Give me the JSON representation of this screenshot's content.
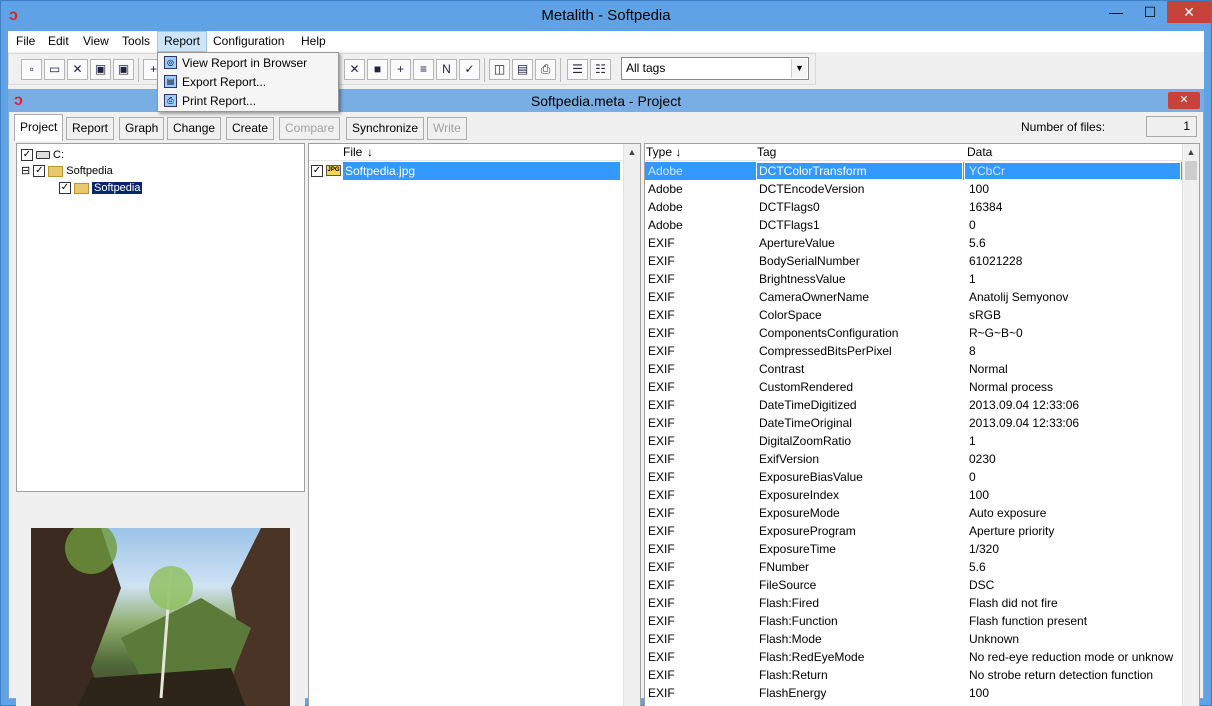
{
  "window": {
    "title": "Metalith - Softpedia",
    "min": "—",
    "max": "☐",
    "close": "✕"
  },
  "menu": [
    "File",
    "Edit",
    "View",
    "Tools",
    "Report",
    "Configuration",
    "Help"
  ],
  "report_menu": [
    "View Report in Browser",
    "Export Report...",
    "Print Report..."
  ],
  "toolbar": {
    "tag_filter": "All tags"
  },
  "project": {
    "title": "Softpedia.meta - Project",
    "close": "✕",
    "tabs": [
      "Project",
      "Report",
      "Graph",
      "Change",
      "Create",
      "Compare",
      "Synchronize",
      "Write"
    ],
    "number_of_files_label": "Number of files:",
    "number_of_files": "1"
  },
  "tree": {
    "drive": "C:",
    "folder": "Softpedia",
    "subfolder": "Softpedia"
  },
  "files": {
    "header": "File",
    "sort_icon": "↓",
    "items": [
      "Softpedia.jpg"
    ],
    "jpg_badge": "JPG"
  },
  "tags_table": {
    "headers": {
      "type": "Type",
      "tag": "Tag",
      "data": "Data"
    },
    "rows": [
      [
        "Adobe",
        "DCTColorTransform",
        "YCbCr"
      ],
      [
        "Adobe",
        "DCTEncodeVersion",
        "100"
      ],
      [
        "Adobe",
        "DCTFlags0",
        "16384"
      ],
      [
        "Adobe",
        "DCTFlags1",
        "0"
      ],
      [
        "EXIF",
        "ApertureValue",
        "5.6"
      ],
      [
        "EXIF",
        "BodySerialNumber",
        "61021228"
      ],
      [
        "EXIF",
        "BrightnessValue",
        "1"
      ],
      [
        "EXIF",
        "CameraOwnerName",
        "Anatolij Semyonov"
      ],
      [
        "EXIF",
        "ColorSpace",
        "sRGB"
      ],
      [
        "EXIF",
        "ComponentsConfiguration",
        "R~G~B~0"
      ],
      [
        "EXIF",
        "CompressedBitsPerPixel",
        "8"
      ],
      [
        "EXIF",
        "Contrast",
        "Normal"
      ],
      [
        "EXIF",
        "CustomRendered",
        "Normal process"
      ],
      [
        "EXIF",
        "DateTimeDigitized",
        "2013.09.04 12:33:06"
      ],
      [
        "EXIF",
        "DateTimeOriginal",
        "2013.09.04 12:33:06"
      ],
      [
        "EXIF",
        "DigitalZoomRatio",
        "1"
      ],
      [
        "EXIF",
        "ExifVersion",
        "0230"
      ],
      [
        "EXIF",
        "ExposureBiasValue",
        "0"
      ],
      [
        "EXIF",
        "ExposureIndex",
        "100"
      ],
      [
        "EXIF",
        "ExposureMode",
        "Auto exposure"
      ],
      [
        "EXIF",
        "ExposureProgram",
        "Aperture priority"
      ],
      [
        "EXIF",
        "ExposureTime",
        "1/320"
      ],
      [
        "EXIF",
        "FNumber",
        "5.6"
      ],
      [
        "EXIF",
        "FileSource",
        "DSC"
      ],
      [
        "EXIF",
        "Flash:Fired",
        "Flash did not fire"
      ],
      [
        "EXIF",
        "Flash:Function",
        "Flash function present"
      ],
      [
        "EXIF",
        "Flash:Mode",
        "Unknown"
      ],
      [
        "EXIF",
        "Flash:RedEyeMode",
        "No red-eye reduction mode or unknow"
      ],
      [
        "EXIF",
        "Flash:Return",
        "No strobe return detection function"
      ],
      [
        "EXIF",
        "FlashEnergy",
        "100"
      ]
    ]
  }
}
